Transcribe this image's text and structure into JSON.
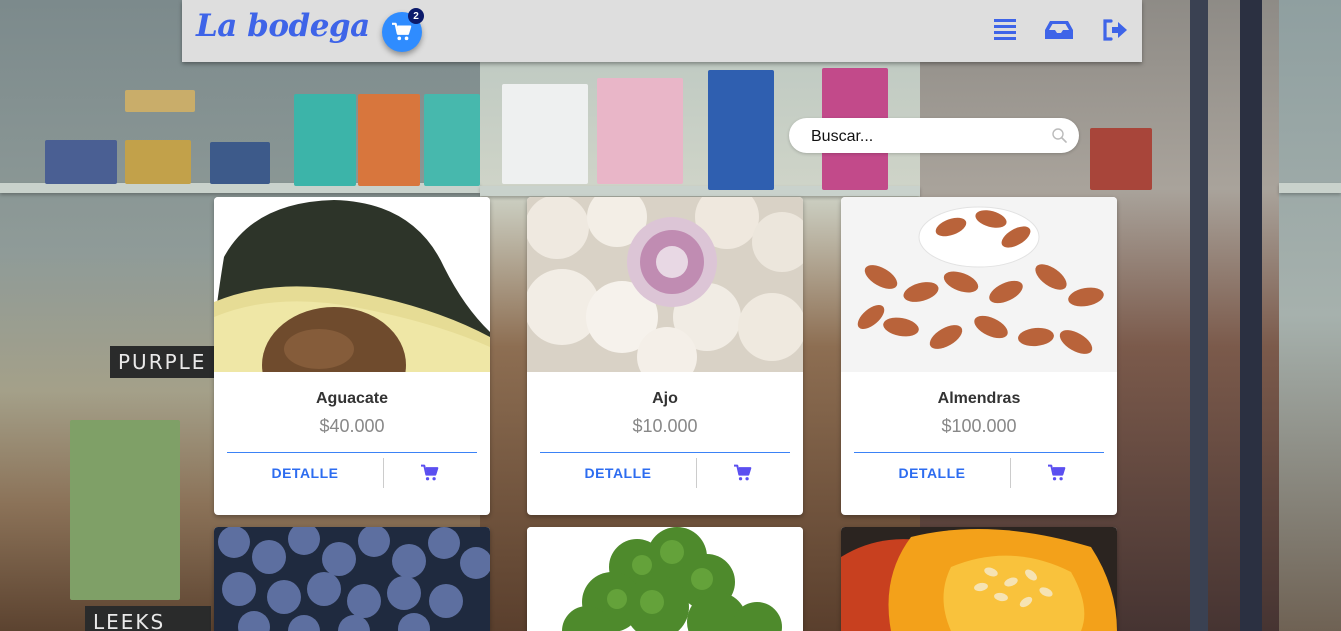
{
  "header": {
    "brand": "La bodega",
    "cart_count": "2",
    "icons": [
      "list-icon",
      "inbox-icon",
      "logout-icon"
    ],
    "brand_color": "#3e64e8",
    "accent_color": "#2f8cff"
  },
  "search": {
    "placeholder": "Buscar..."
  },
  "products": [
    {
      "name": "Aguacate",
      "price": "$40.000",
      "detail_label": "DETALLE"
    },
    {
      "name": "Ajo",
      "price": "$10.000",
      "detail_label": "DETALLE"
    },
    {
      "name": "Almendras",
      "price": "$100.000",
      "detail_label": "DETALLE"
    },
    {
      "name": "",
      "price": "",
      "detail_label": ""
    },
    {
      "name": "",
      "price": "",
      "detail_label": ""
    },
    {
      "name": "",
      "price": "",
      "detail_label": ""
    }
  ],
  "background": {
    "chalkboard_texts": [
      "PURPLE",
      "LEEKS"
    ]
  }
}
